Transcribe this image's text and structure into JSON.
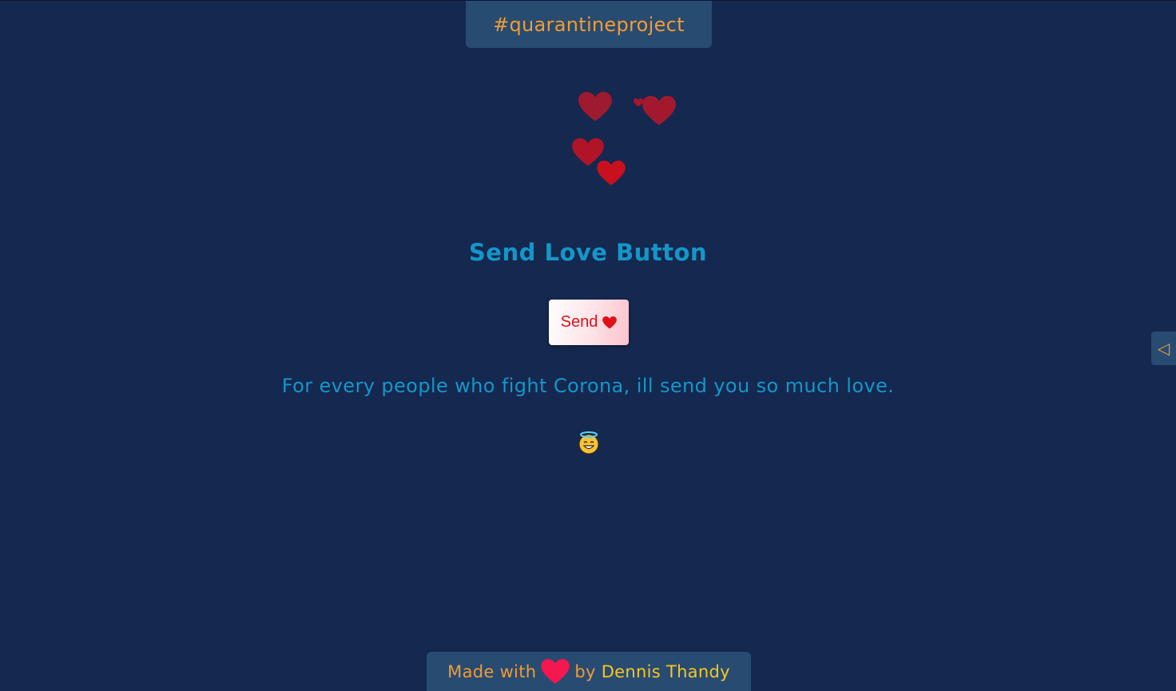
{
  "header": {
    "tag": "#quarantineproject"
  },
  "main": {
    "title": "Send Love Button",
    "send_button_label": "Send",
    "message": "For every people who fight Corona, ill send you so much love.",
    "emoji_icon": "smiling-face-with-halo-icon"
  },
  "side_toggle": {
    "icon": "◁"
  },
  "footer": {
    "made_with": "Made with",
    "by": "by",
    "author": "Dennis Thandy"
  },
  "colors": {
    "background": "#15284f",
    "panel": "#284b71",
    "accent_orange": "#f39b33",
    "accent_yellow": "#f9c623",
    "title_blue": "#1596c9",
    "heart_red": "#e0101b",
    "footer_heart": "#f5174f"
  }
}
